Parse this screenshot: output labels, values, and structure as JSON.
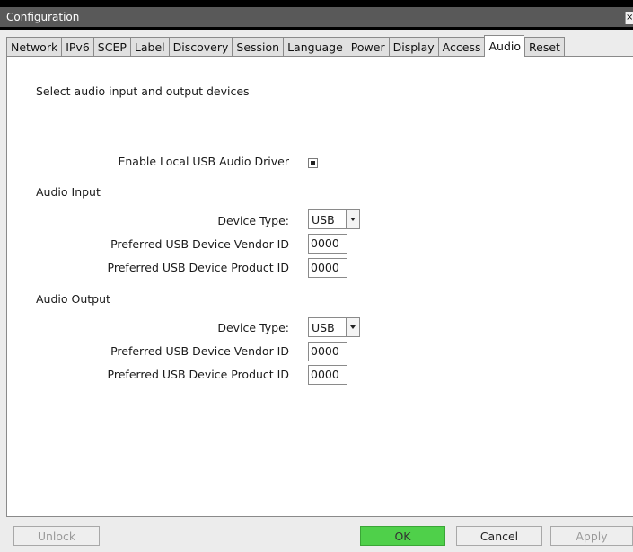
{
  "window": {
    "title": "Configuration",
    "close_label": "×"
  },
  "tabs": [
    {
      "label": "Network",
      "active": false
    },
    {
      "label": "IPv6",
      "active": false
    },
    {
      "label": "SCEP",
      "active": false
    },
    {
      "label": "Label",
      "active": false
    },
    {
      "label": "Discovery",
      "active": false
    },
    {
      "label": "Session",
      "active": false
    },
    {
      "label": "Language",
      "active": false
    },
    {
      "label": "Power",
      "active": false
    },
    {
      "label": "Display",
      "active": false
    },
    {
      "label": "Access",
      "active": false
    },
    {
      "label": "Audio",
      "active": true
    },
    {
      "label": "Reset",
      "active": false
    }
  ],
  "audio": {
    "description": "Select audio input and output devices",
    "enable_usb_label": "Enable Local USB Audio Driver",
    "enable_usb_checked": true,
    "input": {
      "heading": "Audio Input",
      "device_type_label": "Device Type:",
      "device_type_value": "USB",
      "vendor_label": "Preferred USB Device Vendor ID",
      "vendor_value": "0000",
      "product_label": "Preferred USB Device Product ID",
      "product_value": "0000"
    },
    "output": {
      "heading": "Audio Output",
      "device_type_label": "Device Type:",
      "device_type_value": "USB",
      "vendor_label": "Preferred USB Device Vendor ID",
      "vendor_value": "0000",
      "product_label": "Preferred USB Device Product ID",
      "product_value": "0000"
    }
  },
  "buttons": {
    "unlock": "Unlock",
    "ok": "OK",
    "cancel": "Cancel",
    "apply": "Apply"
  },
  "colors": {
    "ok_button": "#4fd04a",
    "title_bar": "#595959"
  }
}
